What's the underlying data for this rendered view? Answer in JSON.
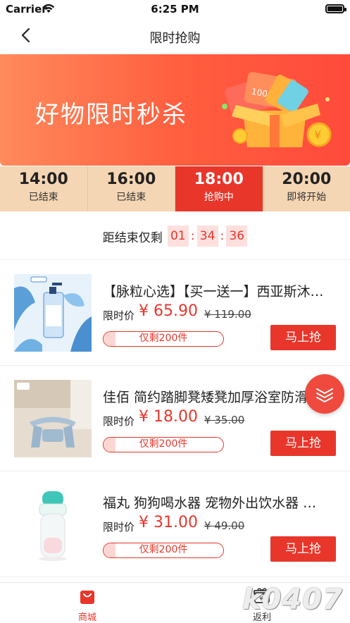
{
  "status_bar": {
    "carrier": "Carrier",
    "time": "6:25 PM"
  },
  "nav": {
    "title": "限时抢购"
  },
  "banner": {
    "headline": "好物限时秒杀",
    "gift_number": "100"
  },
  "sessions": [
    {
      "time": "14:00",
      "status": "已结束"
    },
    {
      "time": "16:00",
      "status": "已结束"
    },
    {
      "time": "18:00",
      "status": "抢购中",
      "active": true
    },
    {
      "time": "20:00",
      "status": "即将开始"
    }
  ],
  "countdown": {
    "label": "距结束仅剩",
    "hours": "01",
    "minutes": "34",
    "seconds": "36"
  },
  "products": [
    {
      "name": "【脉粒心选】【买一送一】西亚斯沐浴露",
      "price_label": "限时价",
      "price": "¥ 65.90",
      "original_price": "¥ 119.00",
      "stock": "仅剩200件",
      "stock_fraction": 0.1,
      "buy_label": "马上抢"
    },
    {
      "name": "佳佰 简约踏脚凳矮凳加厚浴室防滑凳",
      "price_label": "限时价",
      "price": "¥ 18.00",
      "original_price": "¥ 35.00",
      "stock": "仅剩200件",
      "stock_fraction": 0.1,
      "buy_label": "马上抢"
    },
    {
      "name": "福丸 狗狗喝水器 宠物外出饮水器 …",
      "price_label": "限时价",
      "price": "¥ 31.00",
      "original_price": "¥ 49.00",
      "stock": "仅剩200件",
      "stock_fraction": 0.1,
      "buy_label": "马上抢"
    }
  ],
  "tabbar": {
    "home_label": "商城",
    "rebate_label": "返利"
  },
  "watermark": "k0407",
  "colors": {
    "accent": "#e8362b",
    "session_bg": "#f5d6b4",
    "banner_start": "#ff8a5c",
    "banner_end": "#ff4a3c"
  },
  "icons": {
    "back": "chevron-left-icon",
    "float": "expand-down-icon",
    "home": "shopping-bag-icon",
    "rebate": "gift-icon"
  }
}
